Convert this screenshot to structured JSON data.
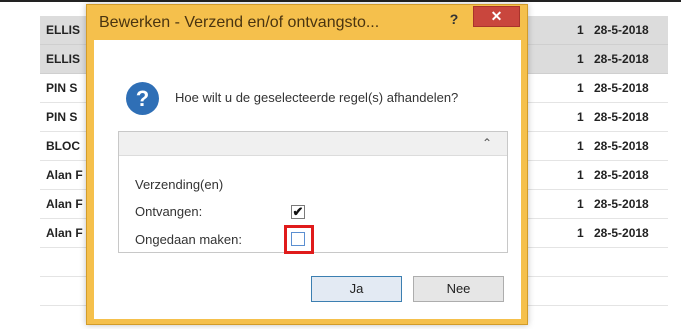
{
  "rows": [
    {
      "name": "ELLIS",
      "qty": "1",
      "date": "28-5-2018"
    },
    {
      "name": "ELLIS",
      "qty": "1",
      "date": "28-5-2018"
    },
    {
      "name": "PIN S",
      "qty": "1",
      "date": "28-5-2018"
    },
    {
      "name": "PIN S",
      "qty": "1",
      "date": "28-5-2018"
    },
    {
      "name": "BLOC",
      "qty": "1",
      "date": "28-5-2018"
    },
    {
      "name": "Alan F",
      "qty": "1",
      "date": "28-5-2018"
    },
    {
      "name": "Alan F",
      "qty": "1",
      "date": "28-5-2018"
    },
    {
      "name": "Alan F",
      "qty": "1",
      "date": "28-5-2018"
    }
  ],
  "dialog": {
    "title": "Bewerken - Verzend en/of ontvangsto...",
    "help_label": "?",
    "close_label": "✕",
    "question_icon": "?",
    "question": "Hoe wilt u de geselecteerde regel(s) afhandelen?",
    "collapse_icon": "⌃",
    "section_label": "Verzending(en)",
    "received_label": "Ontvangen:",
    "received_checked": true,
    "received_mark": "✔",
    "undo_label": "Ongedaan maken:",
    "undo_checked": false,
    "yes_label": "Ja",
    "no_label": "Nee"
  },
  "colors": {
    "dialog_frame": "#f5c04c",
    "close_button": "#c9463d",
    "highlight": "#e01b1b",
    "question_icon": "#2f6fb6"
  }
}
